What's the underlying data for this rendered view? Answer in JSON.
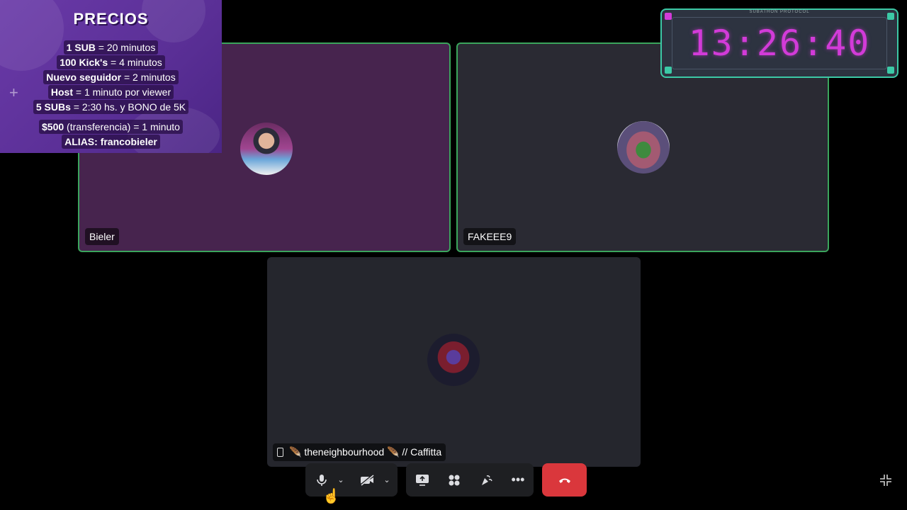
{
  "participants": [
    {
      "name": "Bieler",
      "speaking": true
    },
    {
      "name": "FAKEEE9",
      "speaking": true
    },
    {
      "name": "🪶 theneighbourhood 🪶 // Caffitta",
      "speaking": false,
      "device": "mobile"
    }
  ],
  "prices": {
    "title": "PRECIOS",
    "lines": [
      {
        "bold": "1 SUB",
        "rest": " = 20 minutos"
      },
      {
        "bold": "100 Kick's",
        "rest": " = 4 minutos"
      },
      {
        "bold": "Nuevo seguidor",
        "rest": " = 2 minutos"
      },
      {
        "bold": "Host",
        "rest": " = 1 minuto por viewer"
      },
      {
        "bold": "5 SUBs",
        "rest": " = 2:30 hs. y BONO de 5K"
      },
      {
        "bold": "$500",
        "rest": " (transferencia) = 1 minuto"
      },
      {
        "bold": "ALIAS: francobieler",
        "rest": ""
      }
    ]
  },
  "timer": {
    "label": "SUBATHON PROTOCOL",
    "value": "13:26:40",
    "color": "#d23bd8",
    "frame_color": "#3cc9a6"
  },
  "controls": {
    "mic": "microphone-icon",
    "mic_options": "chevron-down-icon",
    "camera": "camera-off-icon",
    "camera_options": "chevron-down-icon",
    "screen_share": "screen-share-icon",
    "activities": "activities-icon",
    "soundboard": "soundboard-icon",
    "more": "more-icon",
    "disconnect": "phone-hangup-icon",
    "minimize": "minimize-icon"
  },
  "colors": {
    "speaking_border": "#3ba55c",
    "hangup_red": "#da373c",
    "bieler_tile": "#47244e"
  }
}
